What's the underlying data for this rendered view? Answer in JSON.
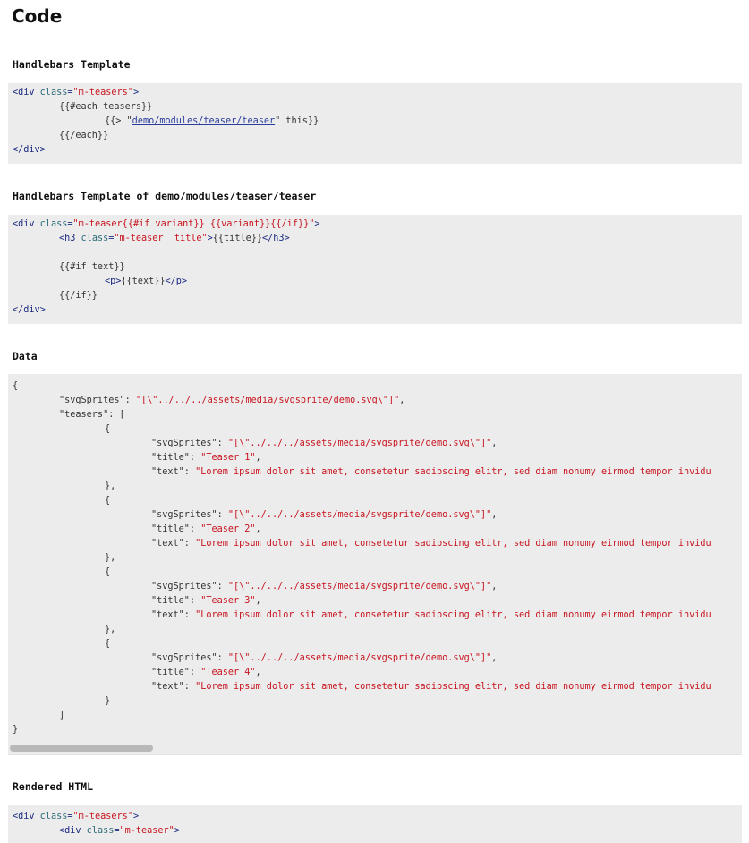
{
  "page_title": "Code",
  "sections": {
    "template": "Handlebars Template",
    "teaser_template": "Handlebars Template of demo/modules/teaser/teaser",
    "data": "Data",
    "rendered": "Rendered HTML"
  },
  "template_code": {
    "l1": [
      "<div ",
      "class",
      "=",
      "\"m-teasers\"",
      ">"
    ],
    "l2": "{{#each teasers}}",
    "l3": [
      "{{> \"",
      "demo/modules/teaser/teaser",
      "\" this}}"
    ],
    "l4": "{{/each}}",
    "l5": "</div>"
  },
  "teaser_code": {
    "l1": [
      "<div ",
      "class",
      "=",
      "\"m-teaser{{#if variant}} {{variant}}{{/if}}\"",
      ">"
    ],
    "l2": [
      "<h3 ",
      "class",
      "=",
      "\"m-teaser__title\"",
      ">",
      "{{title}}",
      "</h3>"
    ],
    "l3": "{{#if text}}",
    "l4": [
      "<p>",
      "{{text}}",
      "</p>"
    ],
    "l5": "{{/if}}",
    "l6": "</div>"
  },
  "data_code": {
    "open": "{",
    "svg_key": "\"svgSprites\": ",
    "svg_val": "\"[\\\"../../../assets/media/svgsprite/demo.svg\\\"]\"",
    "comma": ",",
    "teasers_key": "\"teasers\": [",
    "obj_open": "{",
    "obj_close_comma": "},",
    "obj_close": "}",
    "arr_close": "]",
    "close": "}",
    "title_key": "\"title\": ",
    "text_key": "\"text\": ",
    "text_val": "\"Lorem ipsum dolor sit amet, consetetur sadipscing elitr, sed diam nonumy eirmod tempor invidu",
    "titles": [
      "\"Teaser 1\"",
      "\"Teaser 2\"",
      "\"Teaser 3\"",
      "\"Teaser 4\""
    ]
  },
  "rendered_code": {
    "l1": [
      "<div ",
      "class",
      "=",
      "\"m-teasers\"",
      ">"
    ],
    "l2": [
      "<div ",
      "class",
      "=",
      "\"m-teaser\"",
      ">"
    ]
  }
}
